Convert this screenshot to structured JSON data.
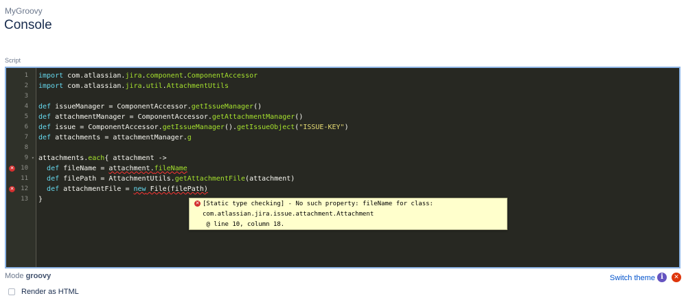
{
  "header": {
    "breadcrumb": "MyGroovy",
    "title": "Console"
  },
  "editor": {
    "label": "Script",
    "lines": [
      {
        "num": "1",
        "tokens": [
          {
            "t": "import",
            "c": "kw"
          },
          {
            "t": " com.atlassian.",
            "c": "plain"
          },
          {
            "t": "jira",
            "c": "fn"
          },
          {
            "t": ".",
            "c": "plain"
          },
          {
            "t": "component",
            "c": "fn"
          },
          {
            "t": ".",
            "c": "plain"
          },
          {
            "t": "ComponentAccessor",
            "c": "fn"
          }
        ]
      },
      {
        "num": "2",
        "tokens": [
          {
            "t": "import",
            "c": "kw"
          },
          {
            "t": " com.atlassian.",
            "c": "plain"
          },
          {
            "t": "jira",
            "c": "fn"
          },
          {
            "t": ".",
            "c": "plain"
          },
          {
            "t": "util",
            "c": "fn"
          },
          {
            "t": ".",
            "c": "plain"
          },
          {
            "t": "AttachmentUtils",
            "c": "fn"
          }
        ]
      },
      {
        "num": "3",
        "tokens": []
      },
      {
        "num": "4",
        "tokens": [
          {
            "t": "def",
            "c": "kw"
          },
          {
            "t": " issueManager = ComponentAccessor.",
            "c": "plain"
          },
          {
            "t": "getIssueManager",
            "c": "fn"
          },
          {
            "t": "()",
            "c": "plain"
          }
        ]
      },
      {
        "num": "5",
        "tokens": [
          {
            "t": "def",
            "c": "kw"
          },
          {
            "t": " attachmentManager = ComponentAccessor.",
            "c": "plain"
          },
          {
            "t": "getAttachmentManager",
            "c": "fn"
          },
          {
            "t": "()",
            "c": "plain"
          }
        ]
      },
      {
        "num": "6",
        "tokens": [
          {
            "t": "def",
            "c": "kw"
          },
          {
            "t": " issue = ComponentAccessor.",
            "c": "plain"
          },
          {
            "t": "getIssueManager",
            "c": "fn"
          },
          {
            "t": "().",
            "c": "plain"
          },
          {
            "t": "getIssueObject",
            "c": "fn"
          },
          {
            "t": "(",
            "c": "plain"
          },
          {
            "t": "\"ISSUE-KEY\"",
            "c": "str"
          },
          {
            "t": ")",
            "c": "plain"
          }
        ]
      },
      {
        "num": "7",
        "tokens": [
          {
            "t": "def",
            "c": "kw"
          },
          {
            "t": " attachments = attachmentManager.",
            "c": "plain"
          },
          {
            "t": "g",
            "c": "fn"
          }
        ]
      },
      {
        "num": "8",
        "tokens": []
      },
      {
        "num": "9",
        "fold": true,
        "tokens": [
          {
            "t": "attachments.",
            "c": "plain"
          },
          {
            "t": "each",
            "c": "fn"
          },
          {
            "t": "{ attachment ->",
            "c": "plain"
          }
        ]
      },
      {
        "num": "10",
        "error": true,
        "tokens": [
          {
            "t": "  ",
            "c": "plain"
          },
          {
            "t": "def",
            "c": "kw"
          },
          {
            "t": " fileName = ",
            "c": "plain"
          },
          {
            "t": "attachment.",
            "c": "plain squig"
          },
          {
            "t": "fileName",
            "c": "fn squig"
          }
        ]
      },
      {
        "num": "11",
        "tokens": [
          {
            "t": "  ",
            "c": "plain"
          },
          {
            "t": "def",
            "c": "kw"
          },
          {
            "t": " filePath = AttachmentUtils.",
            "c": "plain"
          },
          {
            "t": "getAttachmentFile",
            "c": "fn"
          },
          {
            "t": "(attachment)",
            "c": "plain"
          }
        ]
      },
      {
        "num": "12",
        "error": true,
        "tokens": [
          {
            "t": "  ",
            "c": "plain"
          },
          {
            "t": "def",
            "c": "kw"
          },
          {
            "t": " attachmentFile = ",
            "c": "plain"
          },
          {
            "t": "new",
            "c": "kw squig"
          },
          {
            "t": " File(filePath)",
            "c": "plain squig"
          }
        ]
      },
      {
        "num": "13",
        "tokens": [
          {
            "t": "}",
            "c": "plain"
          }
        ]
      }
    ]
  },
  "tooltip": {
    "line1": "[Static type checking] - No such property: fileName for class:",
    "line2": "com.atlassian.jira.issue.attachment.Attachment",
    "line3": " @ line 10, column 18."
  },
  "footer": {
    "mode_prefix": "Mode ",
    "mode_value": "groovy",
    "render_label": "Render as HTML",
    "switch_theme_label": "Switch theme",
    "info_glyph": "i",
    "error_glyph": "✕"
  }
}
